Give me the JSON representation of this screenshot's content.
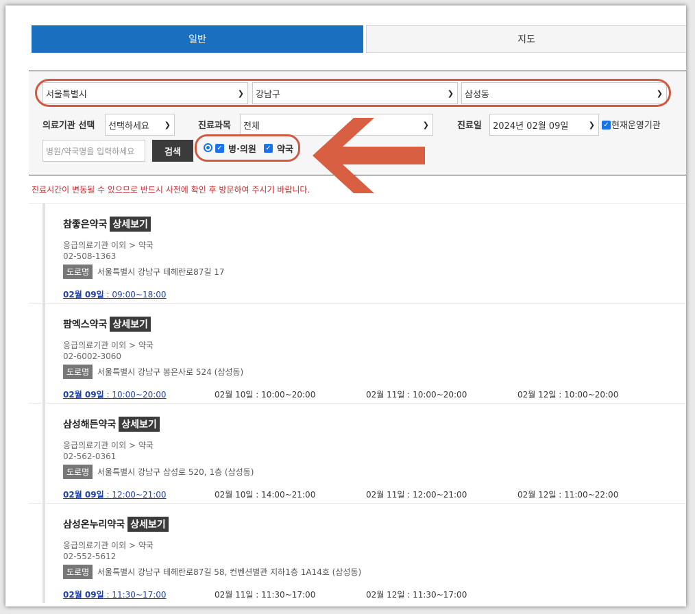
{
  "tabs": [
    {
      "label": "일반"
    },
    {
      "label": "지도"
    }
  ],
  "filters": {
    "city": "서울특별시",
    "district": "강남구",
    "dong": "삼성동",
    "institution_label": "의료기관 선택",
    "institution_value": "선택하세요",
    "department_label": "진료과목",
    "department_value": "전체",
    "date_label": "진료일",
    "date_value": "2024년 02월 09일",
    "open_now_label": "현재운영기관",
    "search_placeholder": "병원/약국명을 입력하세요",
    "search_button": "검색",
    "hospital_label": "병·의원",
    "pharmacy_label": "약국"
  },
  "notice": "진료시간이 변동될 수 있으므로 반드시 사전에 확인 후 방문하여 주시기 바랍니다.",
  "detail_label": "상세보기",
  "road_tag": "도로명",
  "results": [
    {
      "name": "참좋은약국",
      "category": "응급의료기관 이외 > 약국",
      "phone": "02-508-1363",
      "address": "서울특별시 강남구 테헤란로87길 17",
      "hours": [
        {
          "day": "02월 09일",
          "time": " : 09:00~18:00"
        }
      ]
    },
    {
      "name": "팜엑스약국",
      "category": "응급의료기관 이외 > 약국",
      "phone": "02-6002-3060",
      "address": "서울특별시 강남구 봉은사로 524 (삼성동)",
      "hours": [
        {
          "day": "02월 09일",
          "time": " : 10:00~20:00"
        },
        {
          "day": "02월 10일",
          "time": " : 10:00~20:00"
        },
        {
          "day": "02월 11일",
          "time": " : 10:00~20:00"
        },
        {
          "day": "02월 12일",
          "time": " : 10:00~20:00"
        }
      ]
    },
    {
      "name": "삼성해든약국",
      "category": "응급의료기관 이외 > 약국",
      "phone": "02-562-0361",
      "address": "서울특별시 강남구 삼성로 520, 1층 (삼성동)",
      "hours": [
        {
          "day": "02월 09일",
          "time": " : 12:00~21:00"
        },
        {
          "day": "02월 10일",
          "time": " : 14:00~21:00"
        },
        {
          "day": "02월 11일",
          "time": " : 12:00~21:00"
        },
        {
          "day": "02월 12일",
          "time": " : 11:00~22:00"
        }
      ]
    },
    {
      "name": "삼성온누리약국",
      "category": "응급의료기관 이외 > 약국",
      "phone": "02-552-5612",
      "address": "서울특별시 강남구 테헤란로87길 58, 컨벤션별관 지하1층 1A14호 (삼성동)",
      "hours": [
        {
          "day": "02월 09일",
          "time": " : 11:30~17:00"
        },
        {
          "day": "02월 11일",
          "time": " : 11:30~17:00"
        },
        {
          "day": "02월 12일",
          "time": " : 11:30~17:00"
        }
      ]
    }
  ],
  "colors": {
    "active_tab": "#1a6fbf",
    "annotation": "#cf5a42",
    "notice": "#c8282e",
    "link": "#1d3fb0"
  }
}
